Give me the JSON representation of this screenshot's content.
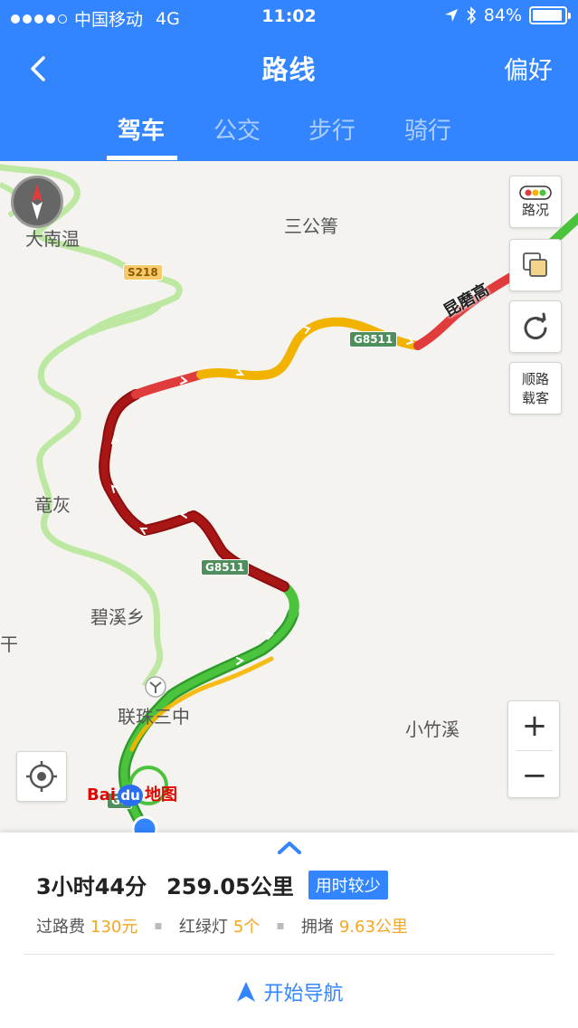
{
  "status_bar": {
    "carrier": "中国移动",
    "network": "4G",
    "time": "11:02",
    "battery": "84%"
  },
  "nav": {
    "title": "路线",
    "preference_label": "偏好"
  },
  "tabs": [
    {
      "label": "驾车",
      "active": true
    },
    {
      "label": "公交",
      "active": false
    },
    {
      "label": "步行",
      "active": false
    },
    {
      "label": "骑行",
      "active": false
    }
  ],
  "map": {
    "place_labels": [
      "大南温",
      "三公箐",
      "竜灰",
      "碧溪乡",
      "干",
      "联珠三中",
      "小竹溪"
    ],
    "road_shields": [
      "S218",
      "G8511",
      "G8511",
      "G8"
    ],
    "highway_name": "昆磨高",
    "controls": {
      "traffic_label": "路况",
      "carpool_label_line1": "顺路",
      "carpool_label_line2": "载客",
      "zoom_in": "+",
      "zoom_out": "−"
    },
    "logo": {
      "bai": "Bai",
      "du": "du",
      "ditu": "地图"
    },
    "traffic_colors": {
      "smooth": "#33b034",
      "slow": "#f7b500",
      "congested": "#e03c3c",
      "severe": "#a30f0f"
    }
  },
  "route_summary": {
    "duration": "3小时44分",
    "distance": "259.05公里",
    "badge": "用时较少",
    "toll_label": "过路费",
    "toll_value": "130元",
    "lights_label": "红绿灯",
    "lights_value": "5个",
    "congestion_label": "拥堵",
    "congestion_value": "9.63公里"
  },
  "start_navigation_label": "开始导航",
  "accent_color": "#3385ff"
}
